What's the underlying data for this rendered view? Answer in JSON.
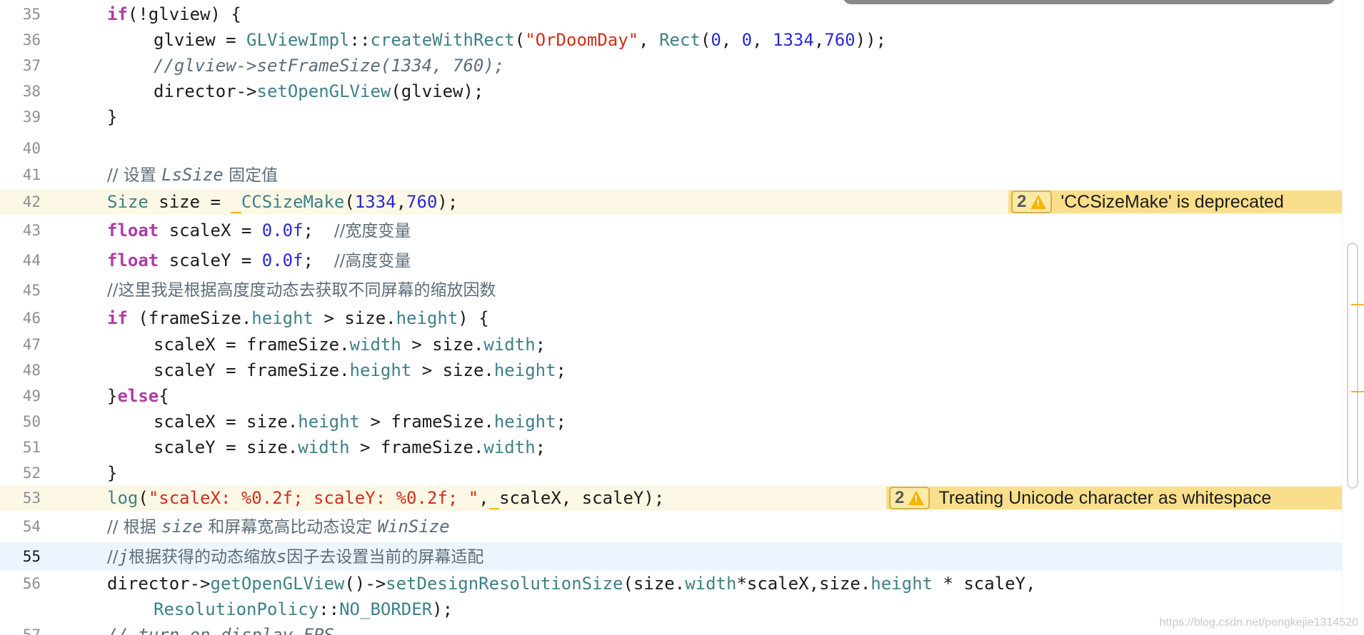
{
  "editor": {
    "current_line": "55",
    "colors": {
      "keyword": "#ad3da4",
      "type": "#3e8087",
      "string": "#d12f1b",
      "number": "#272ad8",
      "comment": "#5d6c79",
      "warning_background": "#f9df8c",
      "current_line_background": "#ecf5fe"
    },
    "lines": [
      {
        "num": "35",
        "tokens": [
          "if",
          "(!glview) {"
        ]
      },
      {
        "num": "36",
        "tokens": [
          "glview = ",
          "GLViewImpl",
          "::",
          "createWithRect",
          "(",
          "\"OrDoomDay\"",
          ", ",
          "Rect",
          "(",
          "0",
          ", ",
          "0",
          ", ",
          "1334",
          ",",
          "760",
          "));"
        ]
      },
      {
        "num": "37",
        "tokens": [
          "//glview->setFrameSize(1334, 760);"
        ]
      },
      {
        "num": "38",
        "tokens": [
          "director->",
          "setOpenGLView",
          "(glview);"
        ]
      },
      {
        "num": "39",
        "tokens": [
          "}"
        ]
      },
      {
        "num": "40",
        "tokens": []
      },
      {
        "num": "41",
        "tokens": [
          "// 设置 ",
          "LsSize",
          " 固定值"
        ]
      },
      {
        "num": "42",
        "tokens": [
          "Size",
          " size = ",
          " ",
          "CCSizeMake",
          "(",
          "1334",
          ",",
          "760",
          ");"
        ]
      },
      {
        "num": "43",
        "tokens": [
          "float",
          " scaleX = ",
          "0.0f",
          ";  ",
          "//宽度变量"
        ]
      },
      {
        "num": "44",
        "tokens": [
          "float",
          " scaleY = ",
          "0.0f",
          ";  ",
          "//高度变量"
        ]
      },
      {
        "num": "45",
        "tokens": [
          "//这里我是根据高度度动态去获取不同屏幕的缩放因数"
        ]
      },
      {
        "num": "46",
        "tokens": [
          "if",
          " (frameSize.",
          "height",
          " > size.",
          "height",
          ") {"
        ]
      },
      {
        "num": "47",
        "tokens": [
          "scaleX = frameSize.",
          "width",
          " > size.",
          "width",
          ";"
        ]
      },
      {
        "num": "48",
        "tokens": [
          "scaleY = frameSize.",
          "height",
          " > size.",
          "height",
          ";"
        ]
      },
      {
        "num": "49",
        "tokens": [
          "}",
          "else",
          "{"
        ]
      },
      {
        "num": "50",
        "tokens": [
          "scaleX = size.",
          "height",
          " > frameSize.",
          "height",
          ";"
        ]
      },
      {
        "num": "51",
        "tokens": [
          "scaleY = size.",
          "width",
          " > frameSize.",
          "width",
          ";"
        ]
      },
      {
        "num": "52",
        "tokens": [
          "}"
        ]
      },
      {
        "num": "53",
        "tokens": [
          "log",
          "(",
          "\"scaleX: %0.2f; scaleY: %0.2f; \"",
          ",",
          " ",
          "scaleX, scaleY);"
        ]
      },
      {
        "num": "54",
        "tokens": [
          "// 根据 ",
          "size",
          " 和屏幕宽高比动态设定 ",
          "WinSize"
        ]
      },
      {
        "num": "55",
        "tokens": [
          "//",
          "j",
          "根据获得的动态缩放",
          "s",
          "因子去设置当前的屏幕适配"
        ]
      },
      {
        "num": "56",
        "tokens": [
          "director->",
          "getOpenGLView",
          "()->",
          "setDesignResolutionSize",
          "(size.",
          "width",
          "*scaleX,size.",
          "height",
          " * scaleY,"
        ]
      },
      {
        "num": "",
        "tokens": [
          "ResolutionPolicy",
          "::",
          "NO_BORDER",
          ");"
        ]
      },
      {
        "num": "57",
        "tokens": [
          "// turn on display FPS"
        ]
      }
    ]
  },
  "warnings": [
    {
      "line": "42",
      "count": "2",
      "icon": "warning-triangle-icon",
      "message": "'CCSizeMake' is deprecated"
    },
    {
      "line": "53",
      "count": "2",
      "icon": "warning-triangle-icon",
      "message": "Treating Unicode character as whitespace"
    }
  ],
  "watermark": "https://blog.csdn.net/pengkejie1314520"
}
